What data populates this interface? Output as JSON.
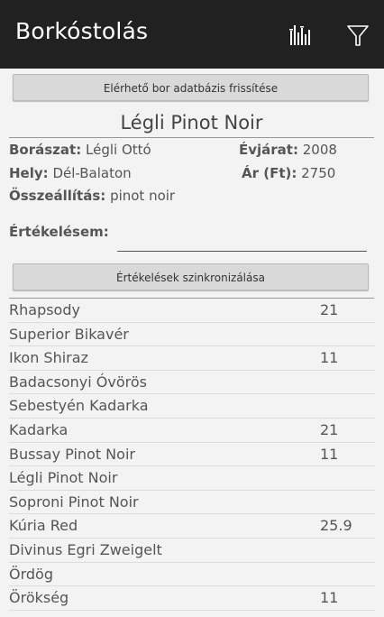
{
  "app": {
    "title": "Borkóstolás"
  },
  "toolbar": {
    "chart_icon": "bar-chart-icon",
    "filter_icon": "filter-icon"
  },
  "buttons": {
    "refresh": "Elérhető bor adatbázis frissítése",
    "sync": "Értékelések szinkronizálása"
  },
  "wine": {
    "name": "Légli Pinot Noir",
    "winery_label": "Borászat:",
    "winery": "Légli Ottó",
    "year_label": "Évjárat:",
    "year": "2008",
    "place_label": "Hely:",
    "place": "Dél-Balaton",
    "price_label": "Ár (Ft):",
    "price": "2750",
    "blend_label": "Összeállítás:",
    "blend": "pinot noir"
  },
  "rating": {
    "label": "Értékelésem:",
    "value": ""
  },
  "list": [
    {
      "name": "Rhapsody",
      "score": "21"
    },
    {
      "name": "Superior Bikavér",
      "score": ""
    },
    {
      "name": "Ikon Shiraz",
      "score": "11"
    },
    {
      "name": "Badacsonyi Óvörös",
      "score": ""
    },
    {
      "name": "Sebestyén Kadarka",
      "score": ""
    },
    {
      "name": "Kadarka",
      "score": "21"
    },
    {
      "name": "Bussay Pinot Noir",
      "score": "11"
    },
    {
      "name": "Légli Pinot Noir",
      "score": ""
    },
    {
      "name": "Soproni Pinot Noir",
      "score": ""
    },
    {
      "name": "Kúria Red",
      "score": "25.9"
    },
    {
      "name": "Divinus Egri Zweigelt",
      "score": ""
    },
    {
      "name": "Ördög",
      "score": ""
    },
    {
      "name": "Örökség",
      "score": "11"
    }
  ]
}
